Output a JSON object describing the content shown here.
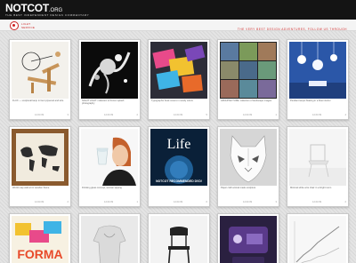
{
  "site": {
    "logo": "NOTCOT",
    "logo_ext": ".ORG",
    "tagline": "THE BEST INDEPENDENT DESIGN COMMENTARY"
  },
  "subheader": {
    "badge_text": "LIGHT SERVICE",
    "follow_text": "THE VERY BEST DESIGN ADVENTURES, FOLLOW US THROUGH",
    "accent_color": "#cc2222"
  },
  "cards": [
    {
      "image": "plywood-desk-lamp-icon",
      "caption": "FLUX — sculptural lamp in bent plywood and wire",
      "date": "12.03.09",
      "count": "3"
    },
    {
      "image": "black-white-splash-photo-icon",
      "caption": "NIGHT LIGHT: collection of frozen splash photography",
      "date": "12.03.09",
      "count": "2"
    },
    {
      "image": "colorful-books-icon",
      "caption": "Typographic book covers in candy colors",
      "date": "12.03.09",
      "count": "5"
    },
    {
      "image": "photo-collage-grid-icon",
      "caption": "ARCHITECTURE: collection of landscape images",
      "date": "12.03.09",
      "count": "1"
    },
    {
      "image": "blue-room-pendant-lamps-icon",
      "caption": "Pendant lamps floating in a blue interior",
      "date": "12.03.09",
      "count": "4"
    },
    {
      "image": "world-map-frame-icon",
      "caption": "World map wall art in wooden frame",
      "date": "12.03.09",
      "count": "2"
    },
    {
      "image": "woman-drinking-glass-icon",
      "caption": "Drinking glass concept, woman sipping",
      "date": "12.03.09",
      "count": "1"
    },
    {
      "image": "life-poster-icon",
      "caption": "Life",
      "overlay": "NOTCOT RECOMMENDED DVD!",
      "date": "12.03.09",
      "count": "6"
    },
    {
      "image": "white-cat-mask-icon",
      "caption": "Paper craft animal mask sculpture",
      "date": "12.03.09",
      "count": "3"
    },
    {
      "image": "white-chair-icon",
      "caption": "Minimal white wire chair in a bright room",
      "date": "12.03.09",
      "count": "2"
    },
    {
      "image": "color-letters-poster-icon",
      "caption": "",
      "letters": "FORMA",
      "date": "",
      "count": ""
    },
    {
      "image": "dress-form-shirt-icon",
      "caption": "",
      "date": "",
      "count": ""
    },
    {
      "image": "black-chair-icon",
      "caption": "",
      "date": "",
      "count": ""
    },
    {
      "image": "product-gadget-icon",
      "caption": "",
      "date": "",
      "count": ""
    },
    {
      "image": "line-chart-screen-icon",
      "caption": "",
      "date": "",
      "count": ""
    }
  ]
}
